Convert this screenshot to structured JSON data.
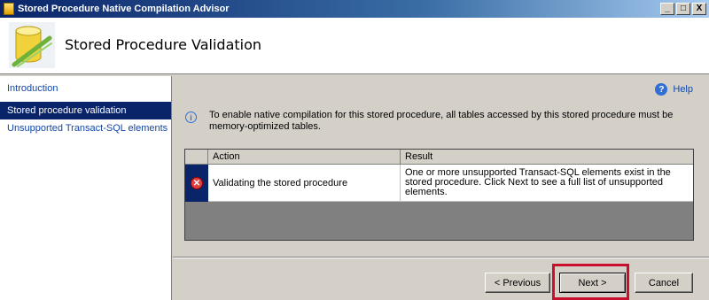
{
  "window": {
    "title": "Stored Procedure Native Compilation Advisor",
    "minimize": "_",
    "maximize": "□",
    "close": "X"
  },
  "header": {
    "title": "Stored Procedure Validation"
  },
  "sidebar": {
    "items": [
      {
        "label": "Introduction"
      },
      {
        "label": "Stored procedure validation",
        "selected": true
      },
      {
        "label": "Unsupported Transact-SQL elements"
      }
    ]
  },
  "help": {
    "label": "Help",
    "icon": "help-icon"
  },
  "info": {
    "icon": "info-icon",
    "text": "To enable native compilation for this stored procedure, all tables accessed by this stored procedure must be memory-optimized tables."
  },
  "grid": {
    "columns": [
      "Action",
      "Result"
    ],
    "rows": [
      {
        "status_icon": "error-icon",
        "action": "Validating the stored procedure",
        "result": "One or more unsupported Transact-SQL elements exist in the stored procedure. Click Next to see a full list of unsupported elements."
      }
    ]
  },
  "buttons": {
    "previous": "< Previous",
    "next": "Next >",
    "cancel": "Cancel"
  },
  "colors": {
    "accent": "#0a246a",
    "link": "#1346a7",
    "highlight": "#c8102e"
  }
}
